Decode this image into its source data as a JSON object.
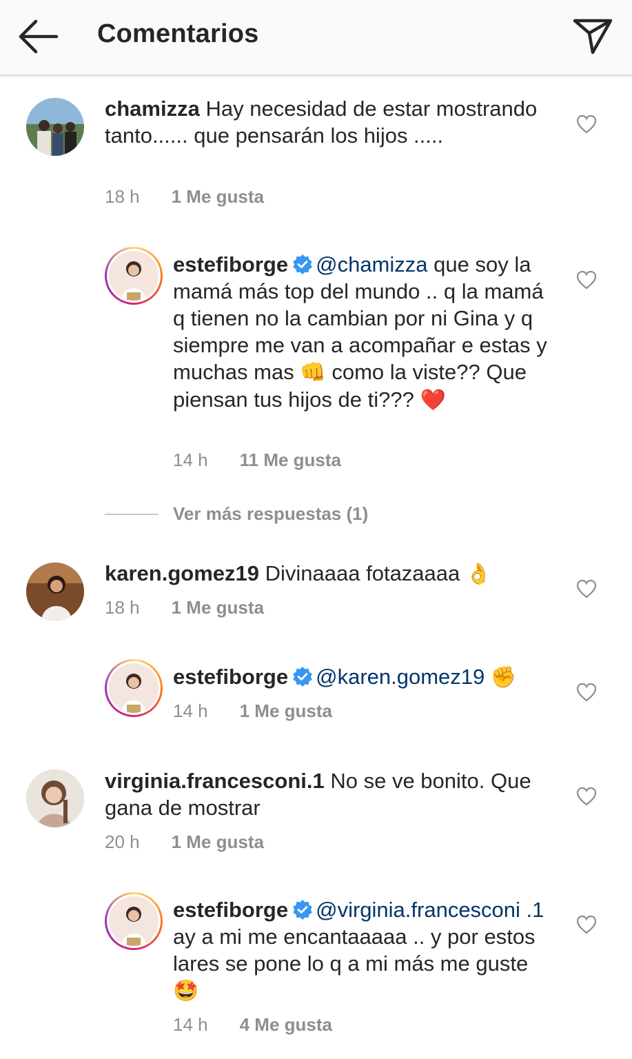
{
  "header": {
    "title": "Comentarios",
    "back_icon": "arrow-left-icon",
    "share_icon": "send-icon"
  },
  "colors": {
    "mention": "#003569",
    "verified": "#3897f0",
    "meta": "#8e8e8e",
    "text": "#262626"
  },
  "comments": [
    {
      "username": "chamizza",
      "text": "Hay necesidad de estar mostrando tanto...... que pensarán los hijos .....",
      "time": "18 h",
      "likes": "1 Me gusta"
    },
    {
      "username": "estefiborge",
      "mention": "@chamizza",
      "text": "que soy la mamá más top del mundo .. q la mamá q tienen no la cambian por ni Gina y q siempre me van a acompañar e estas y muchas mas",
      "text2": "como la viste?? Que piensan tus hijos de ti???",
      "emoji1": "👊",
      "emoji2": "❤️",
      "time": "14 h",
      "likes": "11 Me gusta"
    },
    {
      "username": "karen.gomez19",
      "text": "Divinaaaa fotazaaaa",
      "emoji": "👌",
      "time": "18 h",
      "likes": "1 Me gusta"
    },
    {
      "username": "estefiborge",
      "mention": "@karen.gomez19",
      "emoji": "✊",
      "time": "14 h",
      "likes": "1 Me gusta"
    },
    {
      "username": "virginia.francesconi.1",
      "text": "No se ve bonito.  Que gana de mostrar",
      "time": "20 h",
      "likes": "1 Me gusta"
    },
    {
      "username": "estefiborge",
      "mention": "@virginia.francesconi .1",
      "text": "ay a mi me encantaaaaa .. y por estos lares se pone lo q a mi más me guste",
      "emoji": "🤩",
      "time": "14 h",
      "likes": "4 Me gusta"
    }
  ],
  "view_more": "Ver más respuestas (1)"
}
